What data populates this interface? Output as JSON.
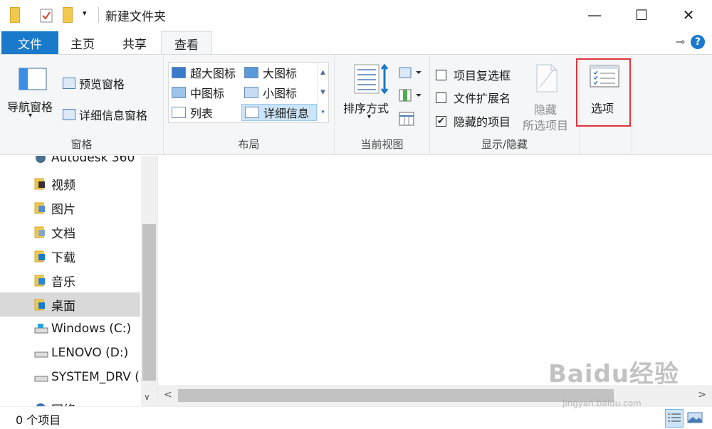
{
  "window": {
    "title": "新建文件夹",
    "minimize": "—",
    "maximize": "☐",
    "close": "✕"
  },
  "tabs": {
    "file": "文件",
    "home": "主页",
    "share": "共享",
    "view": "查看"
  },
  "help_label": "?",
  "ribbon": {
    "panes": {
      "label": "窗格",
      "nav_pane": "导航窗格",
      "preview_pane": "预览窗格",
      "details_pane": "详细信息窗格"
    },
    "layout": {
      "label": "布局",
      "items": [
        "超大图标",
        "大图标",
        "中图标",
        "小图标",
        "列表",
        "详细信息"
      ],
      "selected": "详细信息"
    },
    "current_view": {
      "label": "当前视图",
      "sort_by": "排序方式"
    },
    "show_hide": {
      "label": "显示/隐藏",
      "item_checkboxes": "项目复选框",
      "file_extensions": "文件扩展名",
      "hidden_items": "隐藏的项目",
      "hide_selected_line1": "隐藏",
      "hide_selected_line2": "所选项目",
      "checked": {
        "item_checkboxes": false,
        "file_extensions": false,
        "hidden_items": true
      }
    },
    "options": {
      "label": "选项"
    }
  },
  "nav": {
    "items": [
      {
        "label": "Autodesk 360",
        "icon": "autodesk-icon"
      },
      {
        "label": "视频",
        "icon": "videos-folder-icon"
      },
      {
        "label": "图片",
        "icon": "pictures-folder-icon"
      },
      {
        "label": "文档",
        "icon": "documents-folder-icon"
      },
      {
        "label": "下载",
        "icon": "downloads-folder-icon"
      },
      {
        "label": "音乐",
        "icon": "music-folder-icon"
      },
      {
        "label": "桌面",
        "icon": "desktop-folder-icon"
      },
      {
        "label": "Windows (C:)",
        "icon": "windows-drive-icon"
      },
      {
        "label": "LENOVO (D:)",
        "icon": "drive-icon"
      },
      {
        "label": "SYSTEM_DRV (E",
        "icon": "drive-icon"
      },
      {
        "label": "网络",
        "icon": "network-icon"
      }
    ],
    "selected": "桌面"
  },
  "status": {
    "item_count": "0 个项目"
  },
  "watermark": {
    "brand": "Baidu经验",
    "url": "jingyan.baidu.com"
  },
  "colors": {
    "accent": "#1979ca",
    "highlight": "#e0343a",
    "selection": "#cce4f7"
  }
}
